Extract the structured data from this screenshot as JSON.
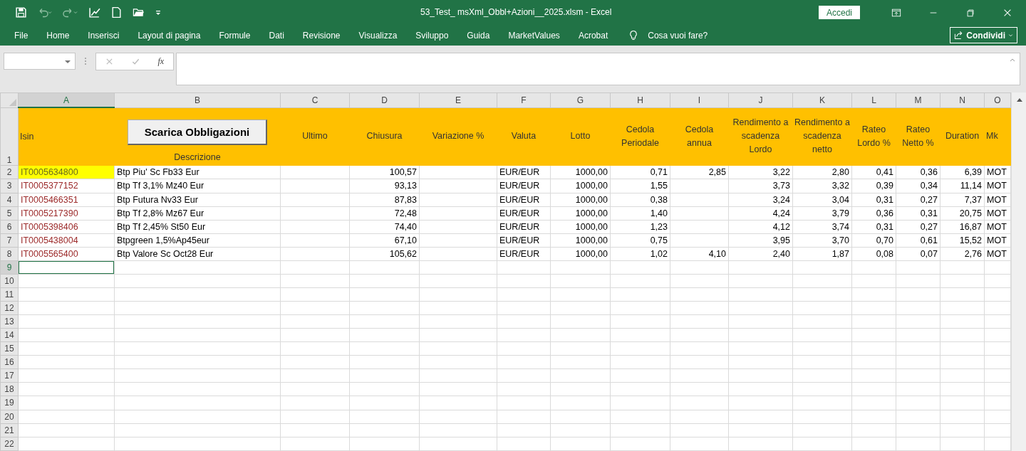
{
  "window": {
    "title": "53_Test_ msXml_Obbl+Azioni__2025.xlsm  -  Excel",
    "sign_in": "Accedi"
  },
  "ribbon": {
    "tabs": [
      "File",
      "Home",
      "Inserisci",
      "Layout di pagina",
      "Formule",
      "Dati",
      "Revisione",
      "Visualizza",
      "Sviluppo",
      "Guida",
      "MarketValues",
      "Acrobat"
    ],
    "search": "Cosa vuoi fare?",
    "share": "Condividi"
  },
  "formula_bar": {
    "fx": "fx"
  },
  "sheet": {
    "columns": [
      {
        "letter": "A",
        "selected": true,
        "kind": "isin",
        "header": "Isin"
      },
      {
        "letter": "B",
        "selected": false,
        "kind": "text",
        "header": "Descrizione",
        "button": "Scarica Obbligazioni"
      },
      {
        "letter": "C",
        "selected": false,
        "kind": "number",
        "header": "Ultimo"
      },
      {
        "letter": "D",
        "selected": false,
        "kind": "number",
        "header": "Chiusura"
      },
      {
        "letter": "E",
        "selected": false,
        "kind": "number",
        "header": "Variazione %"
      },
      {
        "letter": "F",
        "selected": false,
        "kind": "text",
        "header": "Valuta"
      },
      {
        "letter": "G",
        "selected": false,
        "kind": "number",
        "header": "Lotto"
      },
      {
        "letter": "H",
        "selected": false,
        "kind": "number",
        "header": "Cedola Periodale"
      },
      {
        "letter": "I",
        "selected": false,
        "kind": "number",
        "header": "Cedola annua"
      },
      {
        "letter": "J",
        "selected": false,
        "kind": "number",
        "header": "Rendimento a scadenza Lordo"
      },
      {
        "letter": "K",
        "selected": false,
        "kind": "number",
        "header": "Rendimento a scadenza netto"
      },
      {
        "letter": "L",
        "selected": false,
        "kind": "number",
        "header": "Rateo Lordo %"
      },
      {
        "letter": "M",
        "selected": false,
        "kind": "number",
        "header": "Rateo Netto %"
      },
      {
        "letter": "N",
        "selected": false,
        "kind": "number",
        "header": "Duration"
      },
      {
        "letter": "O",
        "selected": false,
        "kind": "market",
        "header": "Mk"
      }
    ],
    "header_row": {
      "label": "1",
      "selected": false
    },
    "rows": [
      {
        "label": "2",
        "selected": false,
        "highlighted": true,
        "cells": [
          "IT0005634800",
          "Btp Piu' Sc Fb33 Eur",
          null,
          "100,57",
          null,
          "EUR/EUR",
          "1000,00",
          "0,71",
          "2,85",
          "3,22",
          "2,80",
          "0,41",
          "0,36",
          "6,39",
          "MOT"
        ]
      },
      {
        "label": "3",
        "selected": false,
        "highlighted": false,
        "cells": [
          "IT0005377152",
          "Btp Tf 3,1% Mz40 Eur",
          null,
          "93,13",
          null,
          "EUR/EUR",
          "1000,00",
          "1,55",
          null,
          "3,73",
          "3,32",
          "0,39",
          "0,34",
          "11,14",
          "MOT"
        ]
      },
      {
        "label": "4",
        "selected": false,
        "highlighted": false,
        "cells": [
          "IT0005466351",
          "Btp Futura Nv33 Eur",
          null,
          "87,83",
          null,
          "EUR/EUR",
          "1000,00",
          "0,38",
          null,
          "3,24",
          "3,04",
          "0,31",
          "0,27",
          "7,37",
          "MOT"
        ]
      },
      {
        "label": "5",
        "selected": false,
        "highlighted": false,
        "cells": [
          "IT0005217390",
          "Btp Tf 2,8% Mz67 Eur",
          null,
          "72,48",
          null,
          "EUR/EUR",
          "1000,00",
          "1,40",
          null,
          "4,24",
          "3,79",
          "0,36",
          "0,31",
          "20,75",
          "MOT"
        ]
      },
      {
        "label": "6",
        "selected": false,
        "highlighted": false,
        "cells": [
          "IT0005398406",
          "Btp Tf 2,45% St50 Eur",
          null,
          "74,40",
          null,
          "EUR/EUR",
          "1000,00",
          "1,23",
          null,
          "4,12",
          "3,74",
          "0,31",
          "0,27",
          "16,87",
          "MOT"
        ]
      },
      {
        "label": "7",
        "selected": false,
        "highlighted": false,
        "cells": [
          "IT0005438004",
          "Btpgreen 1,5%Ap45eur",
          null,
          "67,10",
          null,
          "EUR/EUR",
          "1000,00",
          "0,75",
          null,
          "3,95",
          "3,70",
          "0,70",
          "0,61",
          "15,52",
          "MOT"
        ]
      },
      {
        "label": "8",
        "selected": false,
        "highlighted": false,
        "cells": [
          "IT0005565400",
          "Btp Valore Sc Oct28 Eur",
          null,
          "105,62",
          null,
          "EUR/EUR",
          "1000,00",
          "1,02",
          "4,10",
          "2,40",
          "1,87",
          "0,08",
          "0,07",
          "2,76",
          "MOT"
        ]
      },
      {
        "label": "9",
        "selected": true,
        "highlighted": false,
        "cells": []
      },
      {
        "label": "10",
        "selected": false,
        "highlighted": false,
        "cells": []
      },
      {
        "label": "11",
        "selected": false,
        "highlighted": false,
        "cells": []
      },
      {
        "label": "12",
        "selected": false,
        "highlighted": false,
        "cells": []
      },
      {
        "label": "13",
        "selected": false,
        "highlighted": false,
        "cells": []
      },
      {
        "label": "14",
        "selected": false,
        "highlighted": false,
        "cells": []
      },
      {
        "label": "15",
        "selected": false,
        "highlighted": false,
        "cells": []
      },
      {
        "label": "16",
        "selected": false,
        "highlighted": false,
        "cells": []
      },
      {
        "label": "17",
        "selected": false,
        "highlighted": false,
        "cells": []
      },
      {
        "label": "18",
        "selected": false,
        "highlighted": false,
        "cells": []
      },
      {
        "label": "19",
        "selected": false,
        "highlighted": false,
        "cells": []
      },
      {
        "label": "20",
        "selected": false,
        "highlighted": false,
        "cells": []
      },
      {
        "label": "21",
        "selected": false,
        "highlighted": false,
        "cells": []
      },
      {
        "label": "22",
        "selected": false,
        "highlighted": false,
        "cells": []
      }
    ]
  }
}
